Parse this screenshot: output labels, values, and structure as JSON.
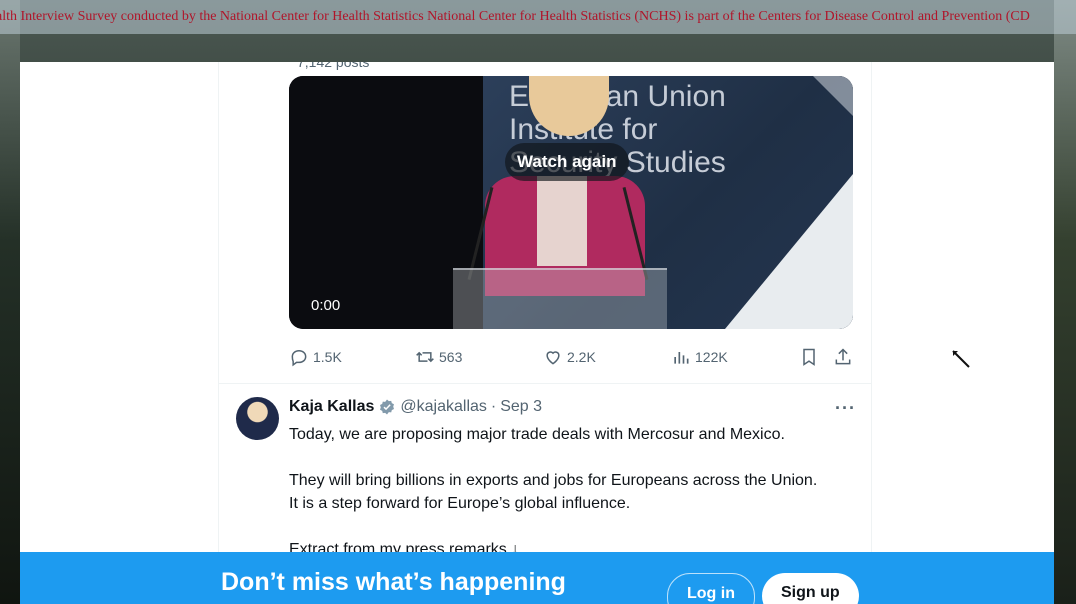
{
  "ticker": {
    "text": "alth Interview Survey conducted by the National Center for Health Statistics National Center for Health Statistics (NCHS) is part of the Centers for Disease Control and Prevention (CD"
  },
  "timeline": {
    "posts_count": "7,142 posts"
  },
  "video": {
    "backdrop_text_lines": [
      "European Union",
      "Institute for",
      "Security Studies"
    ],
    "watch_again_label": "Watch again",
    "timecode": "0:00"
  },
  "actions": {
    "replies": "1.5K",
    "reposts": "563",
    "likes": "2.2K",
    "views": "122K"
  },
  "tweet": {
    "author_name": "Kaja Kallas",
    "handle": "@kajakallas",
    "separator": "·",
    "date": "Sep 3",
    "more_label": "···",
    "lines": [
      "Today, we are proposing major trade deals with Mercosur and Mexico.",
      "They will bring billions in exports and jobs for Europeans across the Union.",
      "It is a step forward for Europe’s global influence.",
      "Extract from my press remarks ↓"
    ]
  },
  "banner": {
    "title": "Don’t miss what’s happening",
    "login_label": "Log in",
    "signup_label": "Sign up"
  },
  "colors": {
    "accent": "#1d9bf0",
    "ticker_text": "#b0152a",
    "muted": "#536471",
    "text": "#0f1419",
    "verified": "#829aab"
  }
}
